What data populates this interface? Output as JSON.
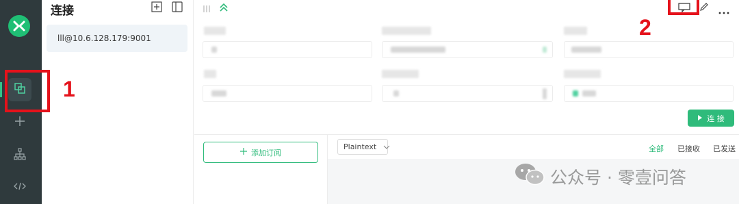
{
  "connections": {
    "title": "连接",
    "items": [
      {
        "label": "lll@10.6.128.179:9001"
      }
    ]
  },
  "main": {
    "connect_button": "连 接"
  },
  "subscriptions": {
    "add_label": "添加订阅"
  },
  "messages": {
    "format_select": "Plaintext",
    "filters": [
      "全部",
      "已接收",
      "已发送"
    ]
  },
  "annotations": {
    "label_1": "1",
    "label_2": "2"
  },
  "watermark": {
    "text": "公众号 · 零壹问答"
  },
  "colors": {
    "rail_bg": "#2f3a3d",
    "accent": "#2fbb7b",
    "annotation": "#e5121b"
  },
  "icons": {
    "logo": "mqttx-logo-icon",
    "rail": [
      "connections-icon",
      "plus-icon",
      "topology-icon",
      "code-icon"
    ],
    "panel": [
      "add-square-icon",
      "sidebar-toggle-icon"
    ],
    "toolbar": [
      "chat-window-icon",
      "edit-icon",
      "more-icon"
    ]
  }
}
